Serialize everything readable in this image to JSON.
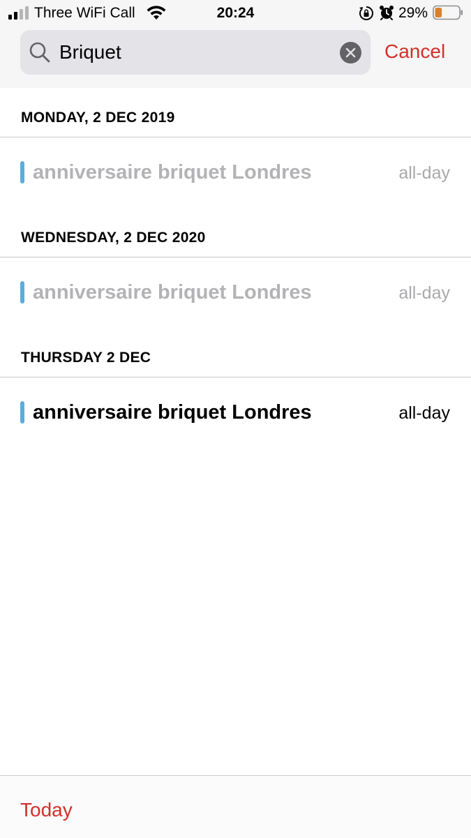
{
  "status_bar": {
    "carrier": "Three WiFi Call",
    "time": "20:24",
    "battery_percent": "29%",
    "battery_level": 0.29,
    "battery_color": "#d9822b",
    "icons": [
      "signal-icon",
      "wifi-icon",
      "rotation-lock-icon",
      "alarm-icon",
      "battery-icon"
    ]
  },
  "search": {
    "value": "Briquet",
    "cancel_label": "Cancel",
    "icon": "search-icon",
    "clear_icon": "clear-icon"
  },
  "sections": [
    {
      "header": "MONDAY, 2 DEC 2019",
      "events": [
        {
          "title": "anniversaire briquet Londres",
          "time": "all-day",
          "past": true
        }
      ]
    },
    {
      "header": "WEDNESDAY, 2 DEC 2020",
      "events": [
        {
          "title": "anniversaire briquet Londres",
          "time": "all-day",
          "past": true
        }
      ]
    },
    {
      "header": "THURSDAY 2 DEC",
      "events": [
        {
          "title": "anniversaire briquet Londres",
          "time": "all-day",
          "past": false
        }
      ]
    }
  ],
  "colors": {
    "accent": "#d0302a",
    "calendar_bar": "#5aaddc",
    "past_text": "#b3b3b6"
  },
  "toolbar": {
    "today_label": "Today"
  }
}
